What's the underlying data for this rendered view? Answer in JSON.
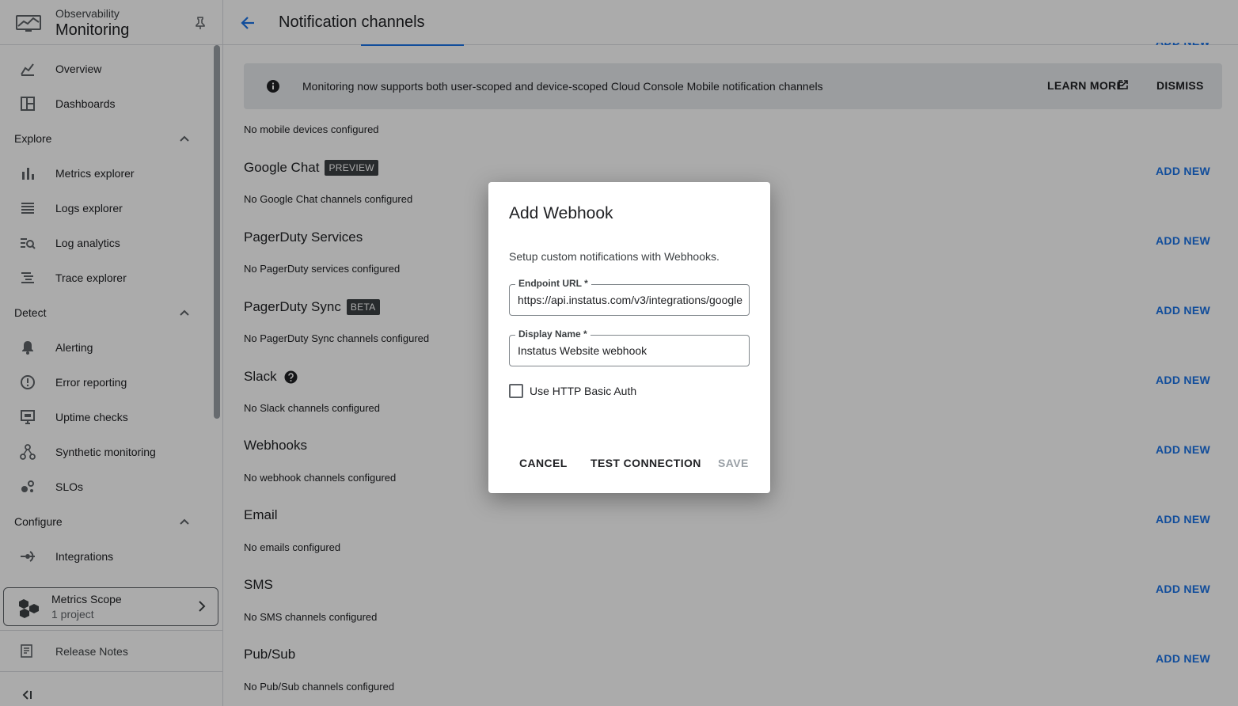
{
  "app": {
    "product_small": "Observability",
    "product_big": "Monitoring"
  },
  "sidebar": {
    "items": [
      {
        "label": "Overview",
        "icon": "overview-chart-icon"
      },
      {
        "label": "Dashboards",
        "icon": "dashboards-icon"
      }
    ],
    "sections": [
      {
        "label": "Explore",
        "items": [
          {
            "label": "Metrics explorer",
            "icon": "bar-chart-icon"
          },
          {
            "label": "Logs explorer",
            "icon": "logs-list-icon"
          },
          {
            "label": "Log analytics",
            "icon": "log-analytics-icon"
          },
          {
            "label": "Trace explorer",
            "icon": "trace-icon"
          }
        ]
      },
      {
        "label": "Detect",
        "items": [
          {
            "label": "Alerting",
            "icon": "bell-icon"
          },
          {
            "label": "Error reporting",
            "icon": "error-reporting-icon"
          },
          {
            "label": "Uptime checks",
            "icon": "monitor-icon"
          },
          {
            "label": "Synthetic monitoring",
            "icon": "synthetic-icon"
          },
          {
            "label": "SLOs",
            "icon": "slo-icon"
          }
        ]
      },
      {
        "label": "Configure",
        "items": [
          {
            "label": "Integrations",
            "icon": "integrations-icon"
          }
        ]
      }
    ],
    "metrics_scope": {
      "title": "Metrics Scope",
      "subtitle": "1 project"
    },
    "release_notes": "Release Notes"
  },
  "header": {
    "title": "Notification channels",
    "add_new_top": "ADD NEW"
  },
  "banner": {
    "message": "Monitoring now supports both user-scoped and device-scoped Cloud Console Mobile notification channels",
    "learn_more": "LEARN MORE",
    "dismiss": "DISMISS"
  },
  "no_mobile": "No mobile devices configured",
  "channels": [
    {
      "title": "Google Chat",
      "badge": "PREVIEW",
      "empty": "No Google Chat channels configured",
      "action": "ADD NEW"
    },
    {
      "title": "PagerDuty Services",
      "badge": "",
      "empty": "No PagerDuty services configured",
      "action": "ADD NEW"
    },
    {
      "title": "PagerDuty Sync",
      "badge": "BETA",
      "empty": "No PagerDuty Sync channels configured",
      "action": "ADD NEW"
    },
    {
      "title": "Slack",
      "badge": "",
      "empty": "No Slack channels configured",
      "action": "ADD NEW"
    },
    {
      "title": "Webhooks",
      "badge": "",
      "empty": "No webhook channels configured",
      "action": "ADD NEW"
    },
    {
      "title": "Email",
      "badge": "",
      "empty": "No emails configured",
      "action": "ADD NEW"
    },
    {
      "title": "SMS",
      "badge": "",
      "empty": "No SMS channels configured",
      "action": "ADD NEW"
    },
    {
      "title": "Pub/Sub",
      "badge": "",
      "empty": "No Pub/Sub channels configured",
      "action": "ADD NEW"
    }
  ],
  "dialog": {
    "title": "Add Webhook",
    "description": "Setup custom notifications with Webhooks.",
    "endpoint_label": "Endpoint URL *",
    "endpoint_value": "https://api.instatus.com/v3/integrations/google",
    "display_label": "Display Name *",
    "display_value": "Instatus Website webhook",
    "basic_auth_label": "Use HTTP Basic Auth",
    "basic_auth_checked": false,
    "cancel": "CANCEL",
    "test": "TEST CONNECTION",
    "save": "SAVE"
  },
  "colors": {
    "accent": "#1a73e8",
    "badge_bg": "#3c4043",
    "scrim": "rgba(0,0,0,0.33)"
  }
}
